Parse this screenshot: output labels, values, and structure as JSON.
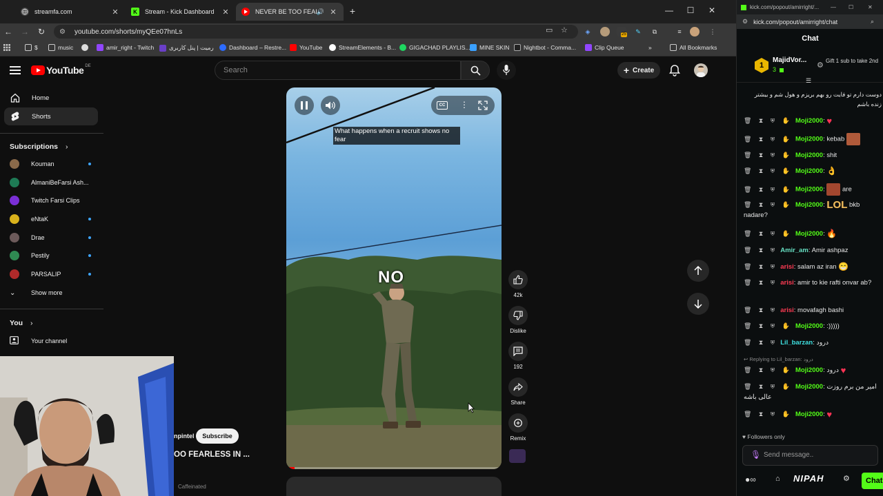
{
  "browser": {
    "tabs": [
      {
        "title": "streamfa.com",
        "favicon_color": "#2b2b2b"
      },
      {
        "title": "Stream - Kick Dashboard",
        "favicon_color": "#53fc18"
      },
      {
        "title": "NEVER BE TOO FEARLESS II",
        "favicon_color": "#ff0000",
        "active": true
      }
    ],
    "url": "youtube.com/shorts/myQEe07hnLs",
    "bookmarks": [
      {
        "label": "$",
        "icon": "folder-icon"
      },
      {
        "label": "music",
        "icon": "folder-icon"
      },
      {
        "label": "",
        "icon": "github-icon"
      },
      {
        "label": "amir_right - Twitch",
        "icon": "twitch-icon"
      },
      {
        "label": "رمیت | پنل کاربری",
        "icon": "purple-app-icon"
      },
      {
        "label": "Dashboard – Restre...",
        "icon": "restream-icon"
      },
      {
        "label": "YouTube",
        "icon": "youtube-icon"
      },
      {
        "label": "StreamElements - B...",
        "icon": "streamelements-icon"
      },
      {
        "label": "GIGACHAD PLAYLIS...",
        "icon": "spotify-icon"
      },
      {
        "label": "MINE SKIN",
        "icon": "blue-bird-icon"
      },
      {
        "label": "Nightbot - Comma...",
        "icon": "nightbot-icon"
      },
      {
        "label": "Clip Queue",
        "icon": "twitch-icon"
      },
      {
        "label": "All Bookmarks",
        "icon": "folder-icon"
      }
    ],
    "extension_badge": "25"
  },
  "youtube": {
    "logo_text": "YouTube",
    "country": "DE",
    "search_placeholder": "Search",
    "create_label": "Create",
    "sidebar": {
      "home": "Home",
      "shorts": "Shorts",
      "subscriptions_heading": "Subscriptions",
      "subscriptions": [
        {
          "name": "Kouman",
          "color": "#8a6a4a",
          "new": true
        },
        {
          "name": "AlmaniBeFarsi Ash...",
          "color": "#1e7a55",
          "new": false
        },
        {
          "name": "Twitch Farsi Clips",
          "color": "#7a2fd6",
          "new": false
        },
        {
          "name": "eNtaK",
          "color": "#d9b21c",
          "new": true
        },
        {
          "name": "Drae",
          "color": "#6c5a5a",
          "new": true
        },
        {
          "name": "Pestily",
          "color": "#2f8a52",
          "new": true
        },
        {
          "name": "PARSALIP",
          "color": "#b02a2a",
          "new": true
        }
      ],
      "show_more": "Show more",
      "you_heading": "You",
      "your_channel": "Your channel"
    },
    "short": {
      "caption": "What happens when a recruit shows no fear",
      "overlay_word": "NO",
      "progress": 0.04,
      "channel_name": "npintel",
      "subscribe_label": "Subscribe",
      "title": "OO FEARLESS IN ...",
      "likes": "42k",
      "dislike_label": "Dislike",
      "comments": "192",
      "share_label": "Share",
      "remix_label": "Remix",
      "cc_label": "CC"
    },
    "webcam_caption": "Caffeinated"
  },
  "kick": {
    "window_url": "kick.com/popout/amirright/...",
    "url": "kick.com/popout/amirright/chat",
    "chat_title": "Chat",
    "top_gifter": {
      "rank": "1",
      "name": "MajidVor...",
      "count": "3"
    },
    "gift_cta": "Gift 1 sub to take 2nd",
    "messages": [
      {
        "user": "",
        "text": "دوست دارم تو فایت رو بهم بریزم و هول شم و بیشتر زنده باشم",
        "color": "u-teal"
      },
      {
        "user": "Moji2000",
        "text": "",
        "emote": "heart",
        "color": "u-green"
      },
      {
        "user": "Moji2000",
        "text": "kebab",
        "emote": "face",
        "color": "u-green"
      },
      {
        "user": "Moji2000",
        "text": "shit",
        "color": "u-green"
      },
      {
        "user": "Moji2000",
        "text": "",
        "emote": "ok-hand",
        "color": "u-green"
      },
      {
        "user": "Moji2000",
        "text": "are",
        "emote": "face-pre",
        "color": "u-green"
      },
      {
        "user": "Moji2000",
        "text": "bkb nadare?",
        "emote": "lol",
        "color": "u-green"
      },
      {
        "user": "Moji2000",
        "text": "",
        "emote": "fire",
        "color": "u-green"
      },
      {
        "user": "Amir_am",
        "text": "Amir ashpaz",
        "color": "u-teal"
      },
      {
        "user": "arisi",
        "text": "salam az iran",
        "emote": "grin",
        "color": "u-red"
      },
      {
        "user": "arisi",
        "text": "amir to kie rafti onvar ab?",
        "color": "u-red"
      },
      {
        "user": "arisi",
        "text": "movafagh bashi",
        "color": "u-red"
      },
      {
        "user": "Moji2000",
        "text": ":)))))",
        "color": "u-green"
      },
      {
        "user": "Lil_barzan",
        "text": "درود",
        "color": "u-cyan"
      },
      {
        "user": "Moji2000",
        "text": "درود",
        "emote": "heart",
        "color": "u-green",
        "reply": "Replying to Lil_barzan: درود"
      },
      {
        "user": "Moji2000",
        "text": "امیر من برم روزت عالی باشه",
        "color": "u-green"
      },
      {
        "user": "Moji2000",
        "text": "",
        "emote": "heart",
        "color": "u-green"
      }
    ],
    "followers_only": "Followers only",
    "input_placeholder": "Send message..",
    "bottom_logo": "NIPAH",
    "chat_button": "Chat"
  }
}
